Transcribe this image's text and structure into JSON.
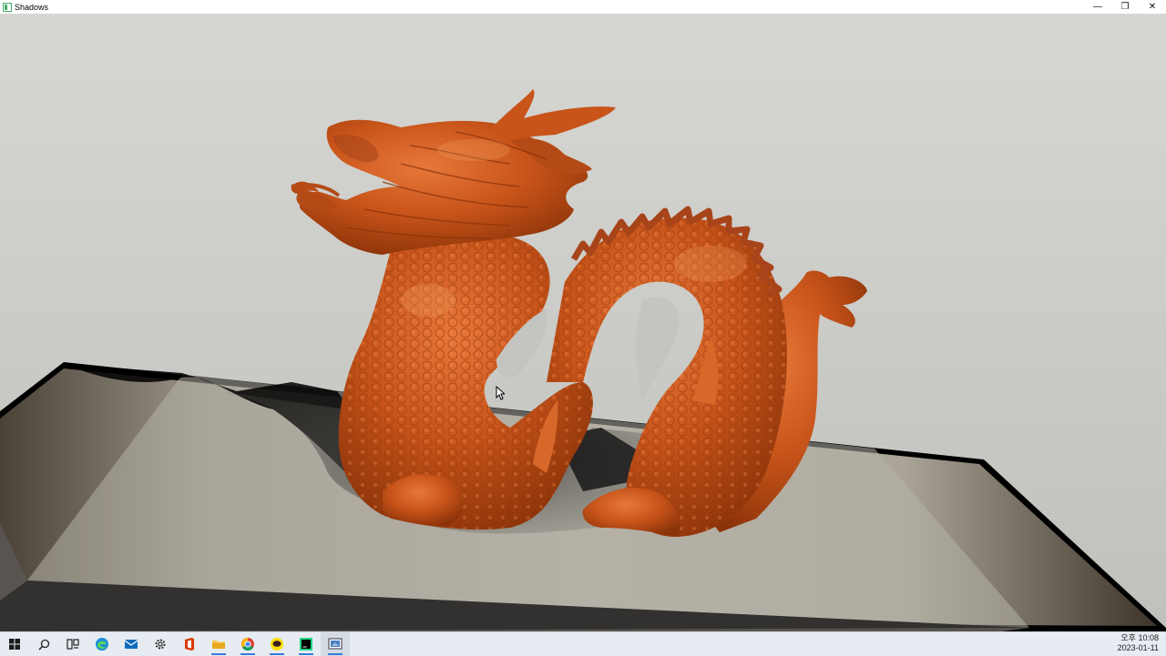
{
  "window": {
    "title": "Shadows",
    "controls": {
      "minimize": "—",
      "restore": "❐",
      "close": "✕"
    }
  },
  "scene": {
    "background_color": "#c4c4c0",
    "object": "dragon",
    "object_color": "#c8541a",
    "floor_color": "#a8a49c"
  },
  "taskbar": {
    "items": [
      {
        "name": "start-icon"
      },
      {
        "name": "search-icon"
      },
      {
        "name": "task-view-icon"
      },
      {
        "name": "edge-icon"
      },
      {
        "name": "mail-icon"
      },
      {
        "name": "settings-icon"
      },
      {
        "name": "office-icon"
      },
      {
        "name": "file-explorer-icon"
      },
      {
        "name": "chrome-icon"
      },
      {
        "name": "kakaotalk-icon"
      },
      {
        "name": "pycharm-icon"
      },
      {
        "name": "shadows-app-icon"
      }
    ],
    "clock_time": "오후 10:08",
    "clock_date": "2023-01-11"
  }
}
